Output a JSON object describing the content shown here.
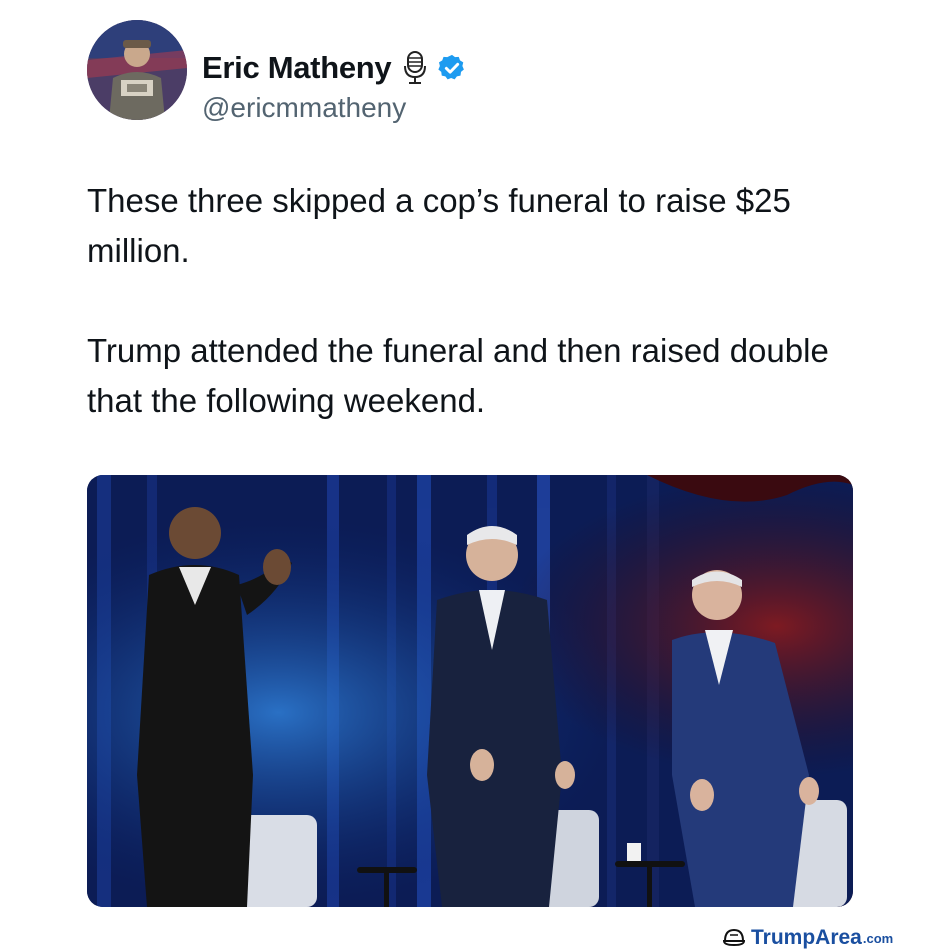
{
  "tweet": {
    "author": {
      "display_name": "Eric Matheny",
      "handle": "@ericmmatheny",
      "avatar_icon": "profile-photo",
      "badges": [
        "microphone-icon",
        "verified-badge-icon"
      ],
      "verified_color": "#1d9bf0"
    },
    "paragraphs": [
      "These three skipped a cop’s funeral to raise $25 million.",
      "Trump attended the funeral and then raised double that the following weekend."
    ],
    "media": {
      "type": "photo"
    }
  },
  "watermark": {
    "name": "TrumpArea",
    "tld": ".com",
    "icon": "hat-icon",
    "color": "#1a4fa0"
  }
}
